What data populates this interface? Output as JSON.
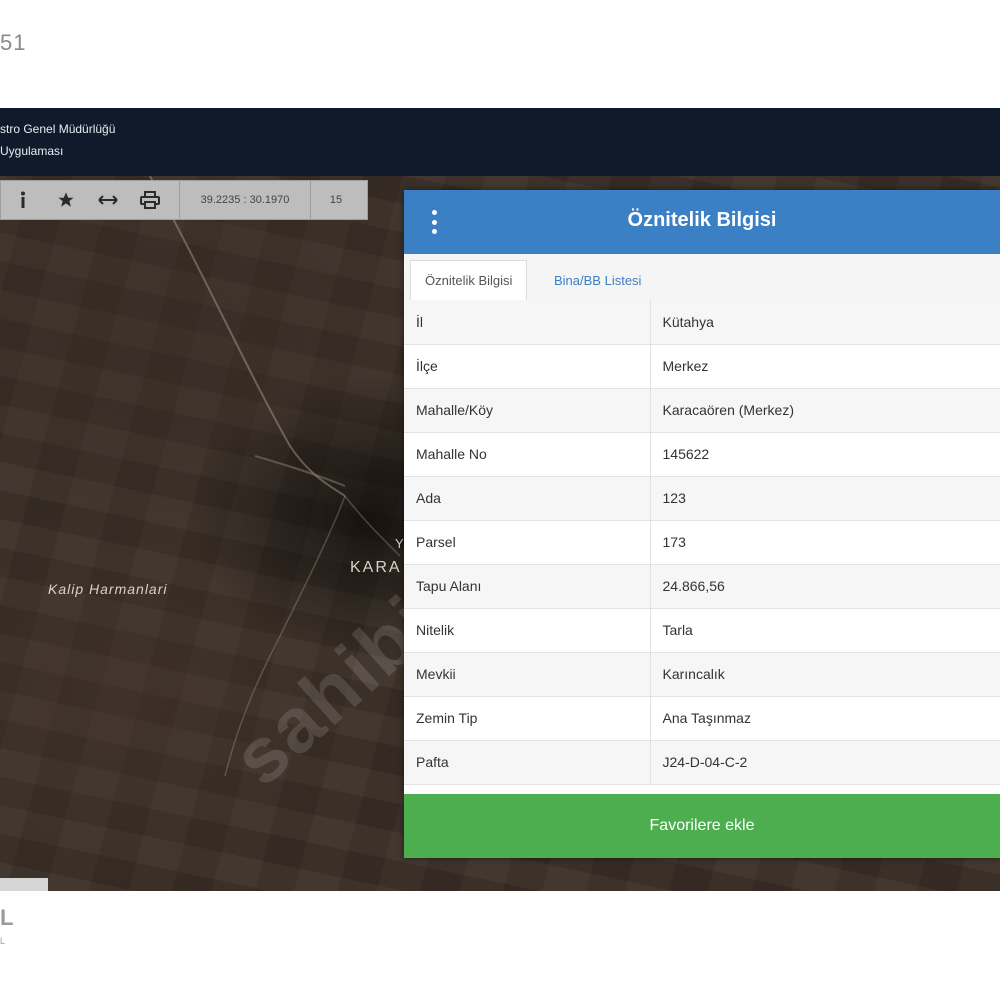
{
  "corner_number": "51",
  "app_header": {
    "line1": "stro Genel Müdürlüğü",
    "line2": "Uygulaması"
  },
  "toolbar": {
    "icons": [
      "info-icon",
      "star-icon",
      "measure-icon",
      "print-icon"
    ],
    "coordinates": "39.2235 : 30.1970",
    "zoom": "15"
  },
  "map": {
    "label_harman": "Kalip Harmanlari",
    "label_kara": "KARA",
    "label_y": "Y",
    "watermark": "sahibi"
  },
  "panel": {
    "title": "Öznitelik Bilgisi",
    "tabs": [
      {
        "label": "Öznitelik Bilgisi",
        "active": true
      },
      {
        "label": "Bina/BB Listesi",
        "active": false
      }
    ],
    "rows": [
      {
        "key": "İl",
        "value": "Kütahya"
      },
      {
        "key": "İlçe",
        "value": "Merkez"
      },
      {
        "key": "Mahalle/Köy",
        "value": "Karacaören (Merkez)"
      },
      {
        "key": "Mahalle No",
        "value": "145622"
      },
      {
        "key": "Ada",
        "value": "123"
      },
      {
        "key": "Parsel",
        "value": "173"
      },
      {
        "key": "Tapu Alanı",
        "value": "24.866,56"
      },
      {
        "key": "Nitelik",
        "value": "Tarla"
      },
      {
        "key": "Mevkii",
        "value": "Karıncalık"
      },
      {
        "key": "Zemin Tip",
        "value": "Ana Taşınmaz"
      },
      {
        "key": "Pafta",
        "value": "J24-D-04-C-2"
      }
    ],
    "favorite_button": "Favorilere ekle"
  },
  "footer": {
    "letter": "L",
    "small": "L"
  },
  "colors": {
    "header_bg": "#0f1b2a",
    "panel_header": "#3b7fc4",
    "favorite_button": "#4cae4f",
    "toolbar_bg": "#bdbdbd"
  }
}
